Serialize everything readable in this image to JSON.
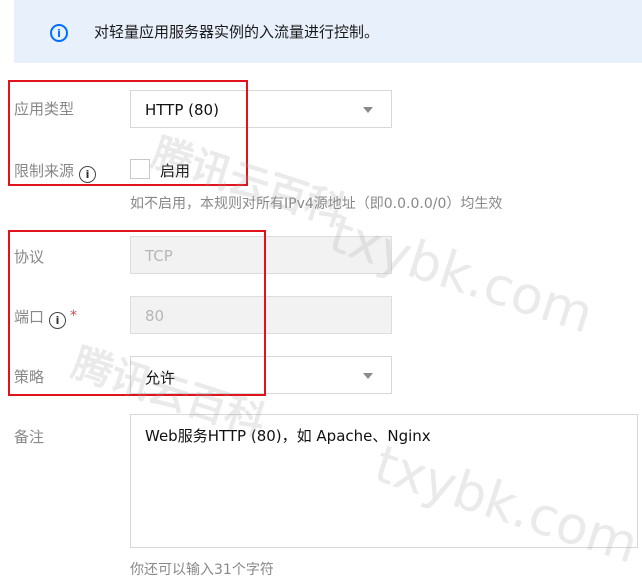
{
  "banner": {
    "icon": "info-icon",
    "icon_glyph": "i",
    "text": "对轻量应用服务器实例的入流量进行控制。"
  },
  "form": {
    "app_type": {
      "label": "应用类型",
      "value": "HTTP (80)"
    },
    "restrict_source": {
      "label": "限制来源",
      "checkbox_label": "启用",
      "checked": false,
      "hint": "如不启用，本规则对所有IPv4源地址（即0.0.0.0/0）均生效"
    },
    "protocol": {
      "label": "协议",
      "value": "TCP"
    },
    "port": {
      "label": "端口",
      "required_mark": "*",
      "value": "80"
    },
    "policy": {
      "label": "策略",
      "value": "允许"
    },
    "remark": {
      "label": "备注",
      "value": "Web服务HTTP (80)，如 Apache、Nginx",
      "counter": "你还可以输入31个字符"
    }
  },
  "tip_icon_glyph": "i",
  "watermarks": {
    "cn": "腾讯云百科",
    "en": "txybk.com"
  },
  "colors": {
    "accent": "#006eff",
    "highlight_box": "#e0121c",
    "banner_bg": "#e8f0fb",
    "required": "#e54545"
  }
}
